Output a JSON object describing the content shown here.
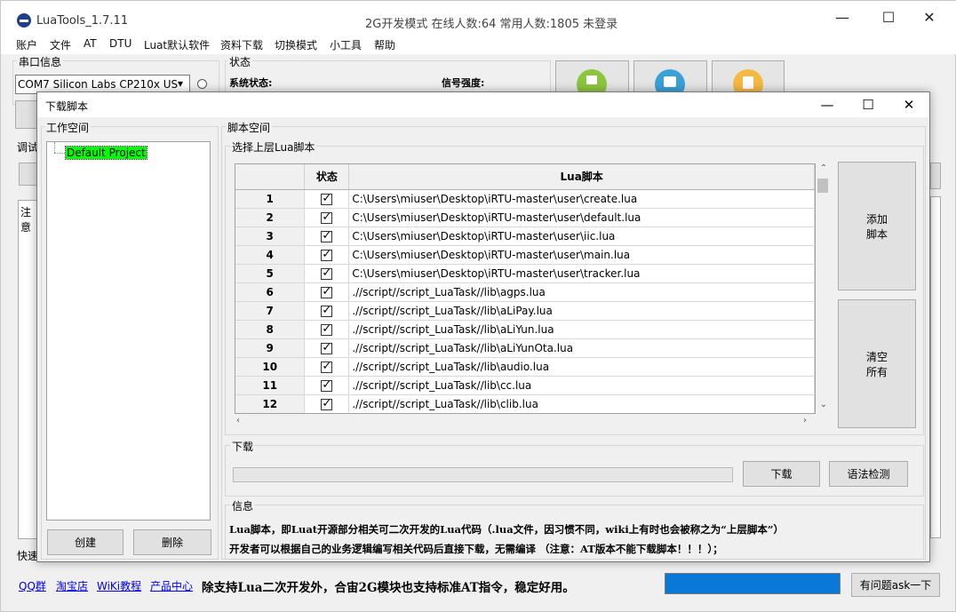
{
  "app": {
    "title": "LuaTools_1.7.11",
    "status_title": "2G开发模式 在线人数:64 常用人数:1805 未登录",
    "min_icon": "—",
    "max_icon": "☐",
    "close_icon": "✕"
  },
  "menu": [
    "账户",
    "文件",
    "AT",
    "DTU",
    "Luat默认软件",
    "资料下载",
    "切换模式",
    "小工具",
    "帮助"
  ],
  "serial": {
    "group_label": "串口信息",
    "port_value": "COM7 Silicon Labs CP210x US",
    "dropdown_icon": "▾"
  },
  "status_panel": {
    "group_label": "状态",
    "system_status_label": "系统状态:",
    "signal_label": "信号强度:"
  },
  "bg_labels": {
    "debug": "调试",
    "note": "注意",
    "quick": "快速"
  },
  "dialog": {
    "title": "下载脚本",
    "workspace_label": "工作空间",
    "project_name": "Default Project",
    "create_button": "创建",
    "delete_button": "删除",
    "script_space_label": "脚本空间",
    "upper_script_label": "选择上层Lua脚本",
    "table": {
      "col_status": "状态",
      "col_script": "Lua脚本",
      "rows": [
        {
          "num": "1",
          "path": "C:\\Users\\miuser\\Desktop\\iRTU-master\\user\\create.lua"
        },
        {
          "num": "2",
          "path": "C:\\Users\\miuser\\Desktop\\iRTU-master\\user\\default.lua"
        },
        {
          "num": "3",
          "path": "C:\\Users\\miuser\\Desktop\\iRTU-master\\user\\iic.lua"
        },
        {
          "num": "4",
          "path": "C:\\Users\\miuser\\Desktop\\iRTU-master\\user\\main.lua"
        },
        {
          "num": "5",
          "path": "C:\\Users\\miuser\\Desktop\\iRTU-master\\user\\tracker.lua"
        },
        {
          "num": "6",
          "path": ".//script//script_LuaTask//lib\\agps.lua"
        },
        {
          "num": "7",
          "path": ".//script//script_LuaTask//lib\\aLiPay.lua"
        },
        {
          "num": "8",
          "path": ".//script//script_LuaTask//lib\\aLiYun.lua"
        },
        {
          "num": "9",
          "path": ".//script//script_LuaTask//lib\\aLiYunOta.lua"
        },
        {
          "num": "10",
          "path": ".//script//script_LuaTask//lib\\audio.lua"
        },
        {
          "num": "11",
          "path": ".//script//script_LuaTask//lib\\cc.lua"
        },
        {
          "num": "12",
          "path": ".//script//script_LuaTask//lib\\clib.lua"
        }
      ]
    },
    "add_script_line1": "添加",
    "add_script_line2": "脚本",
    "clear_all_line1": "清空",
    "clear_all_line2": "所有",
    "download_group_label": "下载",
    "download_button": "下载",
    "syntax_check_button": "语法检测",
    "info_group_label": "信息",
    "info_line1": "Lua脚本，即Luat开源部分相关可二次开发的Lua代码（.lua文件，因习惯不同，wiki上有时也会被称之为“上层脚本”）",
    "info_line2": "开发者可以根据自己的业务逻辑编写相关代码后直接下载，无需编译  （注意：AT版本不能下载脚本！！！）；"
  },
  "footer": {
    "links": [
      "QQ群",
      "淘宝店",
      "WiKi教程",
      "产品中心"
    ],
    "slogan": "除支持Lua二次开发外，合宙2G模块也支持标准AT指令，稳定好用。",
    "ask_button": "有问题ask一下",
    "progress_color": "#0a78d7"
  }
}
